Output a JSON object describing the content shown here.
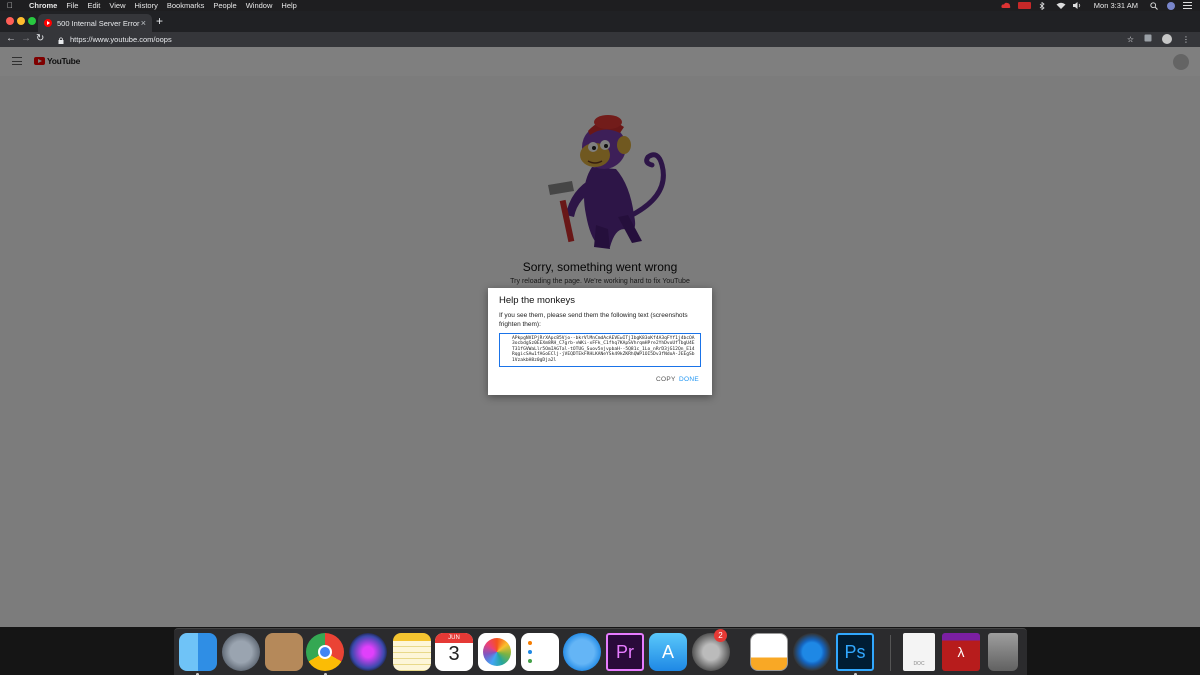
{
  "menubar": {
    "app": "Chrome",
    "items": [
      "File",
      "Edit",
      "View",
      "History",
      "Bookmarks",
      "People",
      "Window",
      "Help"
    ],
    "clock": "Mon 3:31 AM"
  },
  "browser": {
    "tab_title": "500 Internal Server Error",
    "url": "https://www.youtube.com/oops"
  },
  "youtube": {
    "logo_text": "YouTube"
  },
  "error": {
    "title": "Sorry, something went wrong",
    "subtitle": "Try reloading the page. We're working hard to fix YouTube"
  },
  "dialog": {
    "title": "Help the monkeys",
    "text": "If you see them, please send them the following text (screenshots frighten them):",
    "code": "APkpgNVIPjRrXApc85Vjo--bkrVlMnCmdAcAEVEwITjIbgK83oKf4A3qFYf1j4bcOA3ocbdgSz0EEXm8RH_C7grb-vWKi-xFFk_C1fhq7KApSVhrqmHPre2YhDvoUfTbgU4ET31fGVWaLlr5OmIAGTal-tOTUG_Suov5njvpbaH--5Q81c_1Lo_nRrD3jG12Qn_E14RqgicSAw1fAGoEClj-jVEQDTEkFRHLKANeYSk49kZKRhQWP1OI5Dv3fNdoA-JEEgSb1VzakbH8z0gDja2l",
    "copy_label": "COPY",
    "done_label": "DONE"
  },
  "dock": {
    "calendar_month": "JUN",
    "calendar_day": "3",
    "premiere_label": "Pr",
    "photoshop_label": "Ps",
    "file_label": "DOC",
    "prefs_badge": "2"
  }
}
